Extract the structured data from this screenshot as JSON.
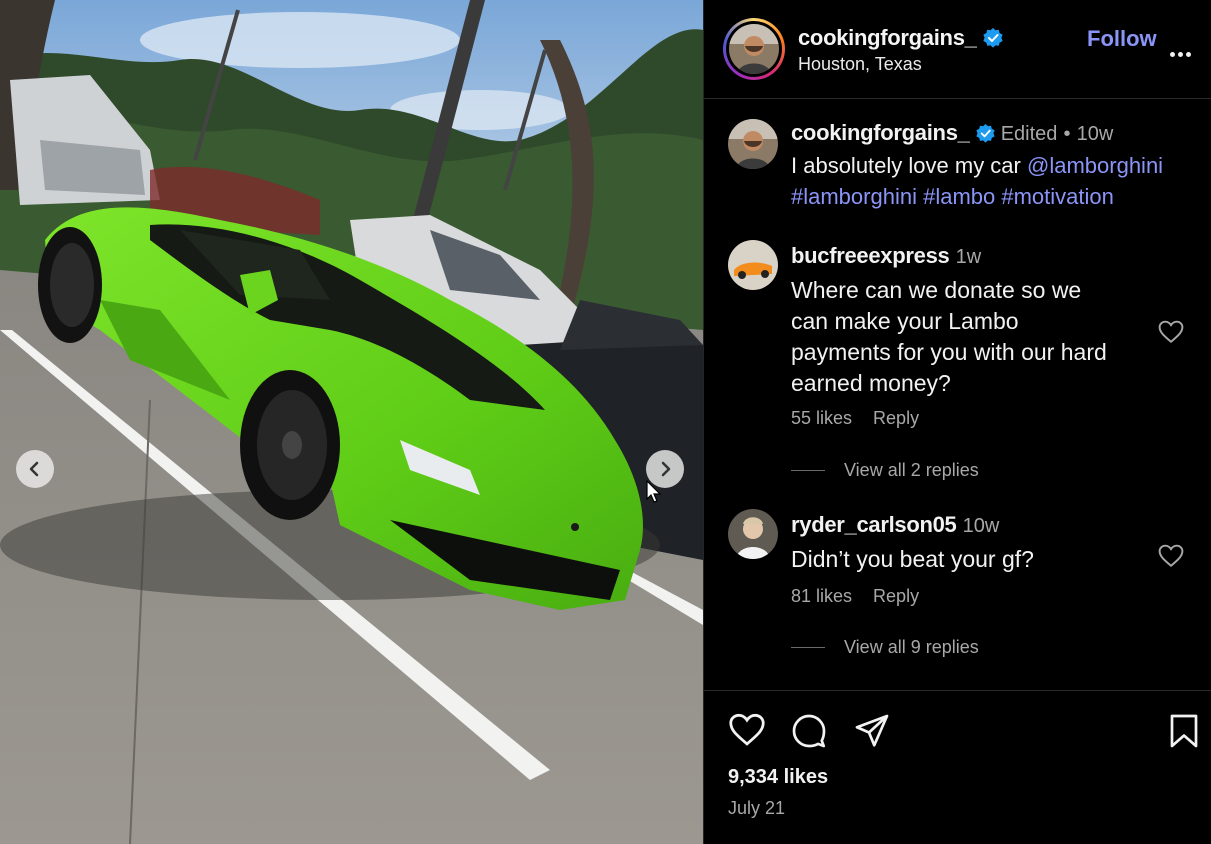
{
  "post": {
    "author": "cookingforgains_",
    "location": "Houston, Texas",
    "follow_label": "Follow",
    "caption_author": "cookingforgains_",
    "caption_edited": "Edited",
    "caption_dot": "•",
    "caption_time": "10w",
    "caption_text": "I absolutely love my car",
    "caption_mention": "@lamborghini",
    "hashtags": [
      "#lamborghini",
      "#lambo",
      "#motivation"
    ],
    "likes": "9,334 likes",
    "date": "July 21"
  },
  "comments": [
    {
      "user": "bucfreeexpress",
      "time": "1w",
      "lines": [
        "Where can we donate so we",
        "can make your Lambo",
        "payments for you with our hard",
        "earned money?"
      ],
      "likes": "55 likes",
      "reply": "Reply",
      "view_replies": "View all 2 replies"
    },
    {
      "user": "ryder_carlson05",
      "time": "10w",
      "lines": [
        "Didn’t you beat your gf?"
      ],
      "likes": "81 likes",
      "reply": "Reply",
      "view_replies": "View all 9 replies"
    }
  ],
  "icons": {
    "verified": "verified-badge-icon",
    "more": "more-options-icon",
    "like": "heart-icon",
    "comment": "comment-icon",
    "share": "paper-plane-icon",
    "save": "bookmark-icon",
    "prev": "chevron-left-icon",
    "next": "chevron-right-icon"
  },
  "colors": {
    "link": "#8b95f7",
    "verified": "#1d9bf0",
    "car": "#6fd61b",
    "background": "#000000"
  }
}
